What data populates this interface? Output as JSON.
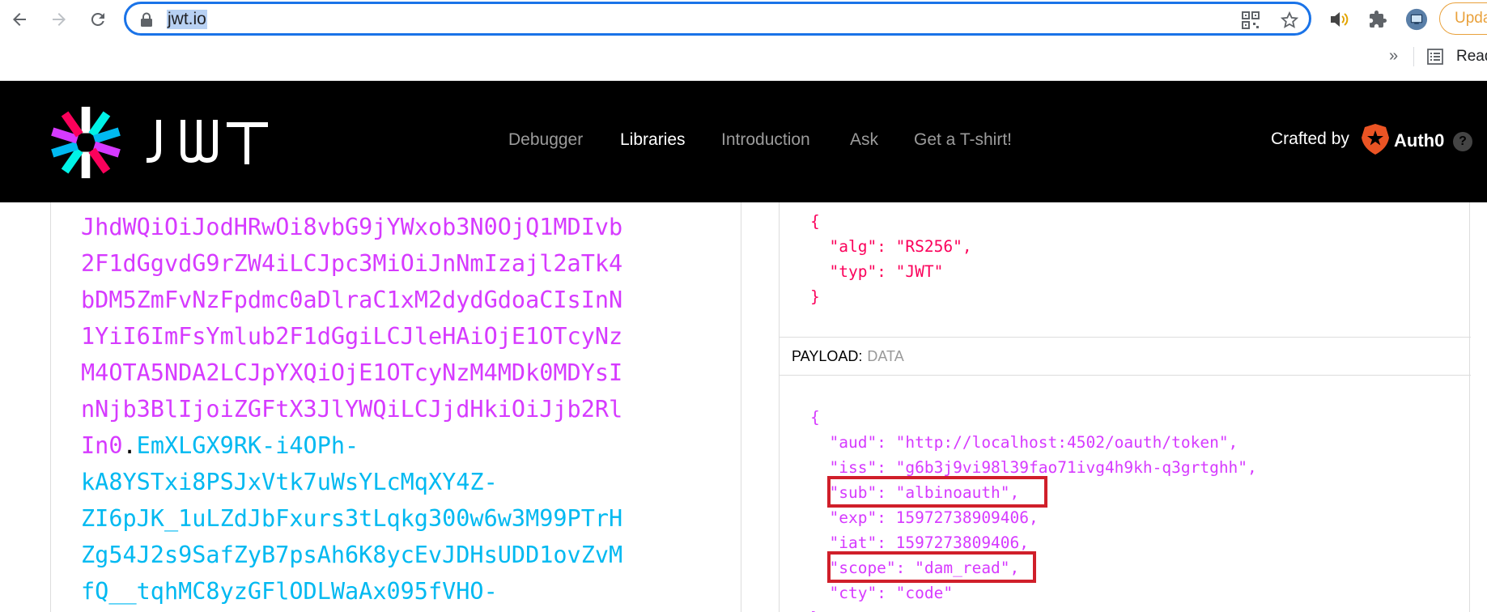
{
  "browser": {
    "url": "jwt.io",
    "update_label": "Upda",
    "bookmarks_more": "»",
    "reading_list_label": "Read",
    "icons": [
      "back-arrow-icon",
      "forward-arrow-icon",
      "reload-icon",
      "lock-icon",
      "qr-code-icon",
      "star-icon",
      "speaker-icon",
      "puzzle-icon",
      "cast-icon",
      "reading-list-icon"
    ]
  },
  "site": {
    "logo_text": "JWT",
    "nav": [
      "Debugger",
      "Libraries",
      "Introduction",
      "Ask",
      "Get a T-shirt!"
    ],
    "active_nav": "Libraries",
    "crafted_by": "Crafted by",
    "auth0_brand": "Auth0",
    "help": "?"
  },
  "encoded": {
    "payload_lines": [
      "JhdWQiOiJodHRwOi8vbG9jYWxob3N0OjQ1MDIvb",
      "2F1dGgvdG9rZW4iLCJpc3MiOiJnNmIzajl2aTk4",
      "bDM5ZmFvNzFpdmc0aDlraC1xM2dydGdoaCIsInN",
      "1YiI6ImFsYmlub2F1dGgiLCJleHAiOjE1OTcyNz",
      "M4OTA5NDA2LCJpYXQiOjE1OTcyNzM4MDk0MDYsI",
      "nNjb3BlIjoiZGFtX3JlYWQiLCJjdHkiOiJjb2Rl",
      "In0"
    ],
    "dot": ".",
    "signature_first": "EmXLGX9RK-i4OPh-",
    "signature_lines": [
      "kA8YSTxi8PSJxVtk7uWsYLcMqXY4Z-",
      "ZI6pJK_1uLZdJbFxurs3tLqkg300w6w3M99PTrH",
      "Zg54J2s9SafZyB7psAh6K8ycEvJDHsUDD1ovZvM",
      "fQ__tqhMC8yzGFlODLWaAx095fVHO-"
    ]
  },
  "decoded": {
    "header_lines": [
      "{",
      "  \"alg\": \"RS256\",",
      "  \"typ\": \"JWT\"",
      "}"
    ],
    "payload_title": "PAYLOAD:",
    "payload_subtitle": "DATA",
    "payload_lines": [
      "{",
      "  \"aud\": \"http://localhost:4502/oauth/token\",",
      "  \"iss\": \"g6b3j9vi98l39fao71ivg4h9kh-q3grtghh\",",
      "  \"sub\": \"albinoauth\",",
      "  \"exp\": 15972738909406,",
      "  \"iat\": 1597273809406,",
      "  \"scope\": \"dam_read\",",
      "  \"cty\": \"code\"",
      "}"
    ]
  },
  "colors": {
    "omnibox_border": "#1a73e8",
    "header_bg": "#000000",
    "payload_purple": "#d63aff",
    "signature_blue": "#00b9f1",
    "header_red": "#fb015b",
    "highlight_red": "#d01f2a",
    "update_orange": "#e9a13b"
  }
}
